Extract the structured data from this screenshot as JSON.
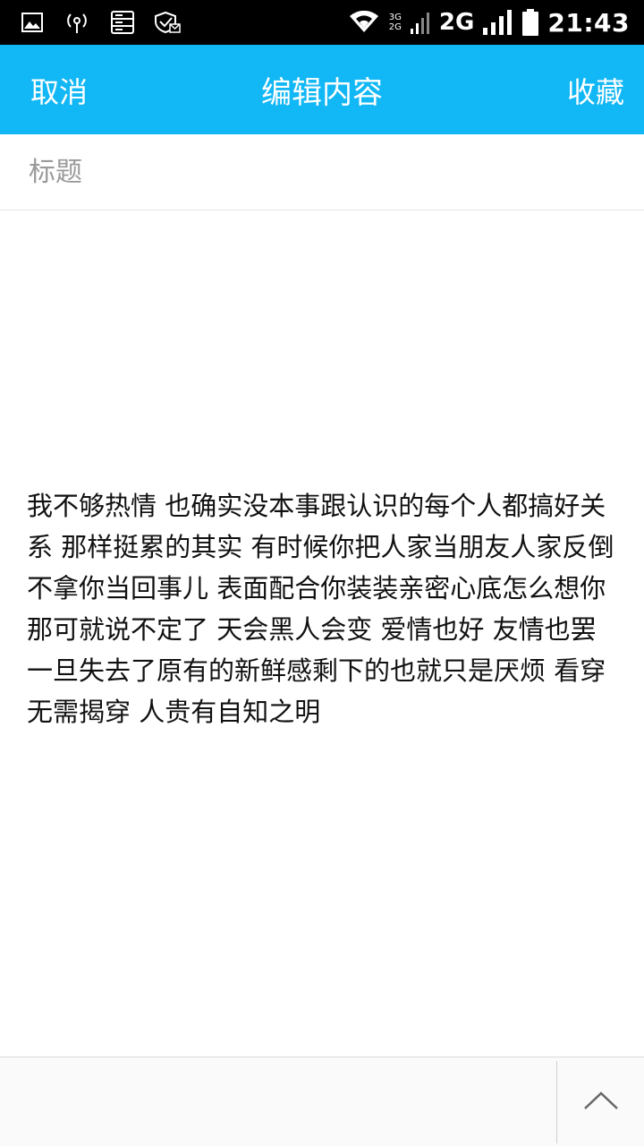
{
  "status_bar": {
    "icons_left": [
      "image-icon",
      "hotspot-icon",
      "storage-icon",
      "shield-mail-icon"
    ],
    "net_small_top": "3G",
    "net_small_bottom": "2G",
    "network": "2G",
    "time": "21:43"
  },
  "header": {
    "cancel_label": "取消",
    "title": "编辑内容",
    "favorite_label": "收藏",
    "accent_color": "#12b7f5"
  },
  "editor": {
    "title_placeholder": "标题",
    "title_value": "",
    "body": "我不够热情 也确实没本事跟认识的每个人都搞好关系 那样挺累的其实 有时候你把人家当朋友人家反倒不拿你当回事儿 表面配合你装装亲密心底怎么想你那可就说不定了 天会黑人会变 爱情也好 友情也罢 一旦失去了原有的新鲜感剩下的也就只是厌烦 看穿无需揭穿 人贵有自知之明"
  },
  "bottom_bar": {
    "collapse_icon": "chevron-up-icon"
  }
}
